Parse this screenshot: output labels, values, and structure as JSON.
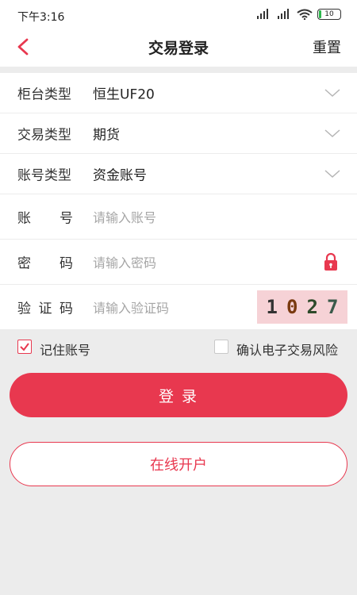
{
  "status_bar": {
    "time": "下午3:16",
    "battery": "10"
  },
  "nav": {
    "title": "交易登录",
    "reset_label": "重置"
  },
  "form": {
    "counter_type": {
      "label": "柜台类型",
      "value": "恒生UF20"
    },
    "trade_type": {
      "label": "交易类型",
      "value": "期货"
    },
    "account_type": {
      "label": "账号类型",
      "value": "资金账号"
    },
    "account": {
      "label": "账        号",
      "placeholder": "请输入账号"
    },
    "password": {
      "label": "密        码",
      "placeholder": "请输入密码"
    },
    "captcha": {
      "label": "验 证 码",
      "placeholder": "请输入验证码",
      "digits": [
        "1",
        "0",
        "2",
        "7"
      ],
      "digit_colors": [
        "#333333",
        "#7a3a10",
        "#2e4a2a",
        "#3a5a4a"
      ]
    }
  },
  "options": {
    "remember_label": "记住账号",
    "remember_checked": true,
    "risk_label": "确认电子交易风险",
    "risk_checked": false
  },
  "buttons": {
    "login_label": "登    录",
    "open_account_label": "在线开户"
  },
  "colors": {
    "accent": "#e8384f",
    "captcha_bg": "#f6d2d6"
  }
}
